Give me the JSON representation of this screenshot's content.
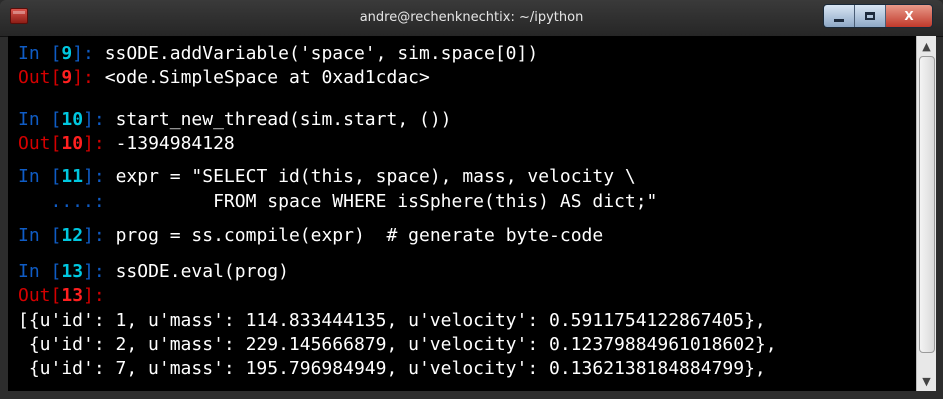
{
  "window": {
    "title": "andre@rechenknechtix: ~/ipython"
  },
  "controls": {
    "minimize": "minimize",
    "maximize": "maximize",
    "close": "X"
  },
  "terminal": {
    "lines": [
      {
        "prompt": "In [",
        "num": "9",
        "suffix": "]: ",
        "text": "ssODE.addVariable('space', sim.space[0])"
      },
      {
        "prompt": "Out[",
        "num": "9",
        "suffix": "]: ",
        "text": "<ode.SimpleSpace at 0xad1cdac>"
      },
      {
        "prompt": "In [",
        "num": "10",
        "suffix": "]: ",
        "text": "start_new_thread(sim.start, ())"
      },
      {
        "prompt": "Out[",
        "num": "10",
        "suffix": "]: ",
        "text": "-1394984128"
      },
      {
        "prompt": "In [",
        "num": "11",
        "suffix": "]: ",
        "text": "expr = \"SELECT id(this, space), mass, velocity \\"
      },
      {
        "prompt": "   ....: ",
        "text": "         FROM space WHERE isSphere(this) AS dict;\""
      },
      {
        "prompt": "In [",
        "num": "12",
        "suffix": "]: ",
        "text": "prog = ss.compile(expr)  # generate byte-code"
      },
      {
        "prompt": "In [",
        "num": "13",
        "suffix": "]: ",
        "text": "ssODE.eval(prog)"
      },
      {
        "prompt": "Out[",
        "num": "13",
        "suffix": "]:"
      },
      {
        "text": "[{u'id': 1, u'mass': 114.833444135, u'velocity': 0.5911754122867405},"
      },
      {
        "text": " {u'id': 2, u'mass': 229.145666879, u'velocity': 0.12379884961018602},"
      },
      {
        "text": " {u'id': 7, u'mass': 195.796984949, u'velocity': 0.1362138184884799},"
      }
    ]
  },
  "scrollbar": {
    "up_glyph": "▲",
    "down_glyph": "▼"
  }
}
